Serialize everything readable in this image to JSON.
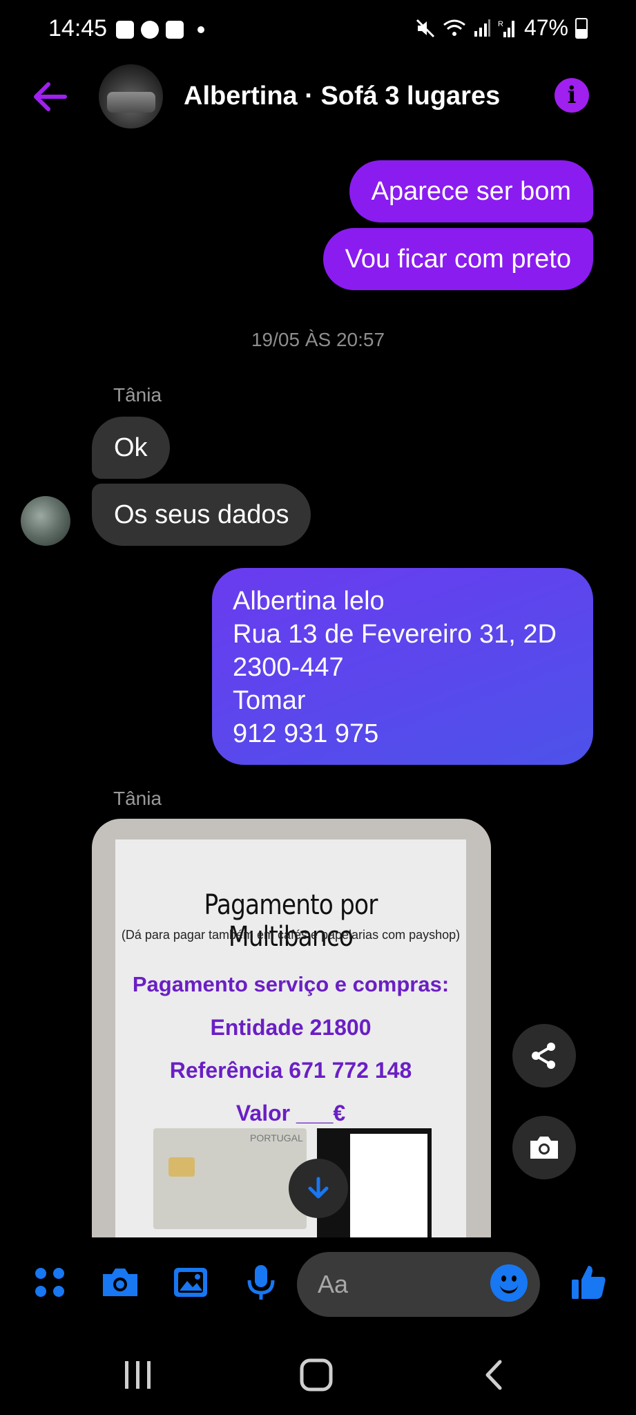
{
  "status_bar": {
    "time": "14:45",
    "battery": "47%",
    "left_icons": [
      "gallery-icon",
      "whatsapp-icon",
      "camera-app-icon",
      "dot-icon"
    ],
    "right_icons": [
      "mute-icon",
      "wifi-icon",
      "signal-icon",
      "signal-r-icon",
      "battery-icon"
    ]
  },
  "header": {
    "title": "Albertina · Sofá 3 lugares",
    "info_glyph": "i",
    "accent_color": "#a020f0"
  },
  "messages": {
    "out1": "Aparece ser bom",
    "out2": "Vou ficar com preto",
    "timestamp": "19/05 ÀS 20:57",
    "sender1": "Tânia",
    "in1": "Ok",
    "in2": "Os seus dados",
    "address": {
      "line1": "Albertina lelo",
      "line2": "Rua 13 de Fevereiro 31, 2D",
      "line3": "2300-447",
      "line4": "Tomar",
      "line5": "912 931 975"
    },
    "sender2": "Tânia"
  },
  "attachment": {
    "title": "Pagamento por Multibanco",
    "subtitle": "(Dá para pagar também em cafés e papelarias com payshop)",
    "line1": "Pagamento serviço e compras:",
    "line2": "Entidade 21800",
    "line3": "Referência 671 772 148",
    "line4": "Valor ___€",
    "card_text": "PORTUGAL"
  },
  "composer": {
    "placeholder": "Aa",
    "tool_color": "#1877f2"
  }
}
